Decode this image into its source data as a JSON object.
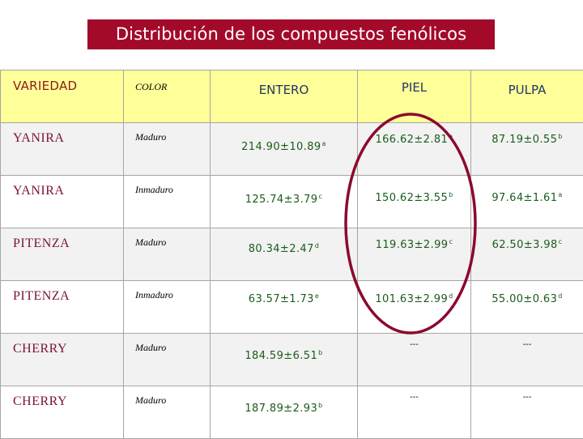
{
  "title": "Distribución de los compuestos fenólicos",
  "colors": {
    "title_bg": "#a30a2a",
    "header_bg": "#ffff99",
    "row_shade": "#f2f2f2",
    "value_text": "#1a5c1a",
    "variety_text": "#7b1133",
    "highlight_ellipse": "#8b0a2e"
  },
  "table": {
    "headers": {
      "variety": "VARIEDAD",
      "color": "COLOR",
      "whole": "ENTERO",
      "skin": "PIEL",
      "pulp": "PULPA"
    },
    "rows": [
      {
        "variety": "YANIRA",
        "color": "Maduro",
        "whole": {
          "value": "214.90±10.89",
          "sup": "a"
        },
        "skin": {
          "value": "166.62±2.81",
          "sup": "a"
        },
        "pulp": {
          "value": "87.19±0.55",
          "sup": "b"
        }
      },
      {
        "variety": "YANIRA",
        "color": "Inmaduro",
        "whole": {
          "value": "125.74±3.79",
          "sup": "c"
        },
        "skin": {
          "value": "150.62±3.55",
          "sup": "b"
        },
        "pulp": {
          "value": "97.64±1.61",
          "sup": "a"
        }
      },
      {
        "variety": "PITENZA",
        "color": "Maduro",
        "whole": {
          "value": "80.34±2.47",
          "sup": "d"
        },
        "skin": {
          "value": "119.63±2.99",
          "sup": "c"
        },
        "pulp": {
          "value": "62.50±3.98",
          "sup": "c"
        }
      },
      {
        "variety": "PITENZA",
        "color": "Inmaduro",
        "whole": {
          "value": "63.57±1.73",
          "sup": "e"
        },
        "skin": {
          "value": "101.63±2.99",
          "sup": "d"
        },
        "pulp": {
          "value": "55.00±0.63",
          "sup": "d"
        }
      },
      {
        "variety": "CHERRY",
        "color": "Maduro",
        "whole": {
          "value": "184.59±6.51",
          "sup": "b"
        },
        "skin": {
          "value": "---",
          "sup": ""
        },
        "pulp": {
          "value": "---",
          "sup": ""
        }
      },
      {
        "variety": "CHERRY",
        "color": "Maduro",
        "whole": {
          "value": "187.89±2.93",
          "sup": "b"
        },
        "skin": {
          "value": "---",
          "sup": ""
        },
        "pulp": {
          "value": "---",
          "sup": ""
        }
      }
    ]
  },
  "annotation": {
    "type": "ellipse",
    "highlighted_column": "PIEL"
  }
}
